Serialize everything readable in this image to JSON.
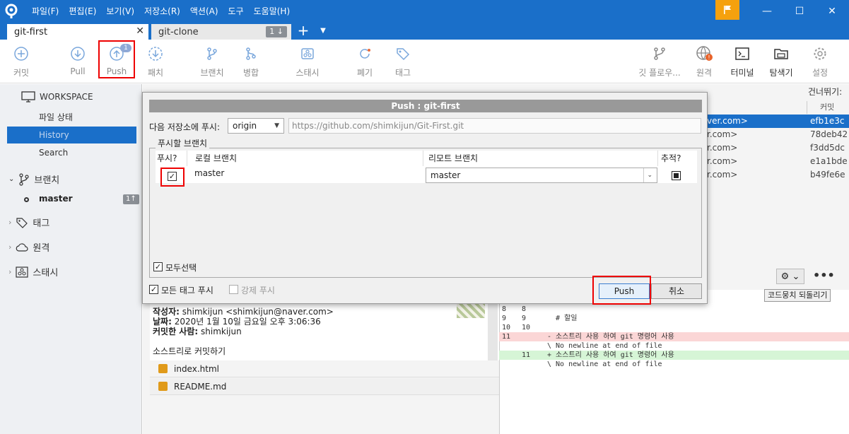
{
  "menu": {
    "items": [
      "파일(F)",
      "편집(E)",
      "보기(V)",
      "저장소(R)",
      "액션(A)",
      "도구",
      "도움말(H)"
    ]
  },
  "window": {
    "minimize": "—",
    "maximize": "☐",
    "close": "✕"
  },
  "tabs": [
    {
      "label": "git-first",
      "close": "✕"
    },
    {
      "label": "git-clone",
      "count": "1 ↓"
    }
  ],
  "tab_add": "+",
  "tab_menu": "▼",
  "toolbar": {
    "commit": "커밋",
    "pull": "Pull",
    "push": "Push",
    "push_badge": "1",
    "fetch": "패치",
    "branch": "브랜치",
    "merge": "병합",
    "stash": "스태시",
    "discard": "폐기",
    "tag": "태그",
    "git_flow": "깃 플로우...",
    "remote": "원격",
    "terminal": "터미널",
    "explorer": "탐색기",
    "settings": "설정"
  },
  "sidebar": {
    "workspace": "WORKSPACE",
    "file_status": "파일 상태",
    "history": "History",
    "search": "Search",
    "branches": "브랜치",
    "branch_master": "master",
    "branch_master_badge": "1↑",
    "tags": "태그",
    "remotes": "원격",
    "stashes": "스태시"
  },
  "history": {
    "skip_label": "건너뛰기:",
    "commit_header": "커밋",
    "rows": [
      {
        "author": "ver.com>",
        "hash": "efb1e3c"
      },
      {
        "author": "r.com>",
        "hash": "78deb42"
      },
      {
        "author": "r.com>",
        "hash": "f3dd5dc"
      },
      {
        "author": "r.com>",
        "hash": "e1a1bde"
      },
      {
        "author": "r.com>",
        "hash": "b49fe6e"
      }
    ]
  },
  "details": {
    "author_label": "작성자:",
    "author_value": "shimkijun <shimkijun@naver.com>",
    "date_label": "날짜:",
    "date_value": "2020년 1월 10일 금요일 오후 3:06:36",
    "committer_label": "커밋한 사람:",
    "committer_value": "shimkijun",
    "message": "소스트리로 커밋하기",
    "files": [
      "index.html",
      "README.md"
    ]
  },
  "diff": {
    "gear": "⚙ ⌄",
    "more": "•••",
    "revert_label": "코드뭉치 되돌리기",
    "lines": [
      {
        "n1": "8",
        "n2": "8",
        "text": "",
        "kind": "ctx"
      },
      {
        "n1": "9",
        "n2": "9",
        "text": "  # 할일",
        "kind": "ctx"
      },
      {
        "n1": "10",
        "n2": "10",
        "text": "",
        "kind": "ctx"
      },
      {
        "n1": "11",
        "n2": "",
        "text": "- 소스트리 사용 하여 git 명령어 사용",
        "kind": "del"
      },
      {
        "n1": "",
        "n2": "",
        "text": "\\ No newline at end of file",
        "kind": "ctx"
      },
      {
        "n1": "",
        "n2": "11",
        "text": "+ 소스트리 사용 하여 git 명령어 사용",
        "kind": "add"
      },
      {
        "n1": "",
        "n2": "",
        "text": "\\ No newline at end of file",
        "kind": "ctx"
      }
    ]
  },
  "dialog": {
    "title": "Push :  git-first",
    "remote_label": "다음 저장소에 푸시:",
    "remote_value": "origin",
    "remote_url": "https://github.com/shimkijun/Git-First.git",
    "group_title": "푸시할 브랜치",
    "col_push": "푸시?",
    "col_local": "로컬 브랜치",
    "col_remote": "리모트 브랜치",
    "col_track": "추적?",
    "row_local": "master",
    "row_remote": "master",
    "select_all": "모두선택",
    "push_all_tags": "모든 태그 푸시",
    "force_push": "강제 푸시",
    "push_button": "Push",
    "cancel_button": "취소",
    "check_mark": "✓"
  }
}
